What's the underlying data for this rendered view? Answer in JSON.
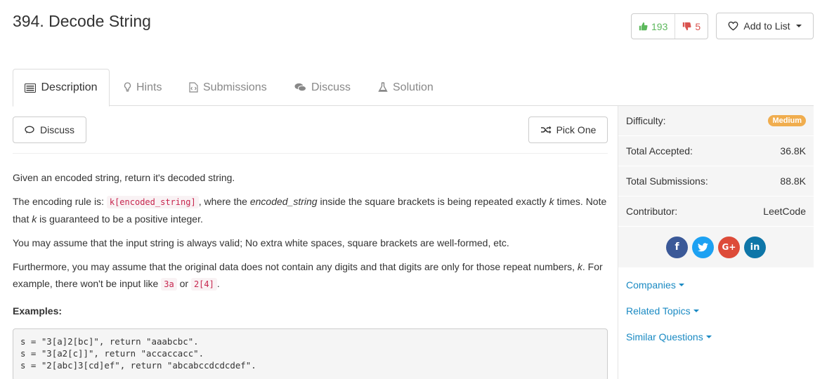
{
  "problem": {
    "title": "394. Decode String"
  },
  "votes": {
    "up": "193",
    "down": "5"
  },
  "add_to_list": "Add to List",
  "tabs": [
    {
      "label": "Description",
      "icon": "list-icon"
    },
    {
      "label": "Hints",
      "icon": "lightbulb-icon"
    },
    {
      "label": "Submissions",
      "icon": "code-file-icon"
    },
    {
      "label": "Discuss",
      "icon": "comments-icon"
    },
    {
      "label": "Solution",
      "icon": "flask-icon"
    }
  ],
  "actions": {
    "discuss": "Discuss",
    "pick_one": "Pick One"
  },
  "description": {
    "p1": "Given an encoded string, return it's decoded string.",
    "p2_a": "The encoding rule is: ",
    "p2_code": "k[encoded_string]",
    "p2_b": ", where the ",
    "p2_em1": "encoded_string",
    "p2_c": " inside the square brackets is being repeated exactly ",
    "p2_em2": "k",
    "p2_d": " times. Note that ",
    "p2_em3": "k",
    "p2_e": " is guaranteed to be a positive integer.",
    "p3": "You may assume that the input string is always valid; No extra white spaces, square brackets are well-formed, etc.",
    "p4_a": "Furthermore, you may assume that the original data does not contain any digits and that digits are only for those repeat numbers, ",
    "p4_em": "k",
    "p4_b": ". For example, there won't be input like ",
    "p4_code1": "3a",
    "p4_or": " or ",
    "p4_code2": "2[4]",
    "p4_end": ".",
    "examples_heading": "Examples:",
    "examples": "s = \"3[a]2[bc]\", return \"aaabcbc\".\ns = \"3[a2[c]]\", return \"accaccacc\".\ns = \"2[abc]3[cd]ef\", return \"abcabccdcdcdef\"."
  },
  "sidebar": {
    "difficulty_label": "Difficulty:",
    "difficulty_value": "Medium",
    "accepted_label": "Total Accepted:",
    "accepted_value": "36.8K",
    "submissions_label": "Total Submissions:",
    "submissions_value": "88.8K",
    "contributor_label": "Contributor:",
    "contributor_value": "LeetCode",
    "social": [
      "facebook-icon",
      "twitter-icon",
      "google-plus-icon",
      "linkedin-icon"
    ],
    "links": [
      "Companies",
      "Related Topics",
      "Similar Questions"
    ]
  },
  "colors": {
    "medium_badge": "#f0ad4e",
    "link": "#1a8ac3",
    "upvote": "#5cb85c",
    "downvote": "#d9534f"
  }
}
